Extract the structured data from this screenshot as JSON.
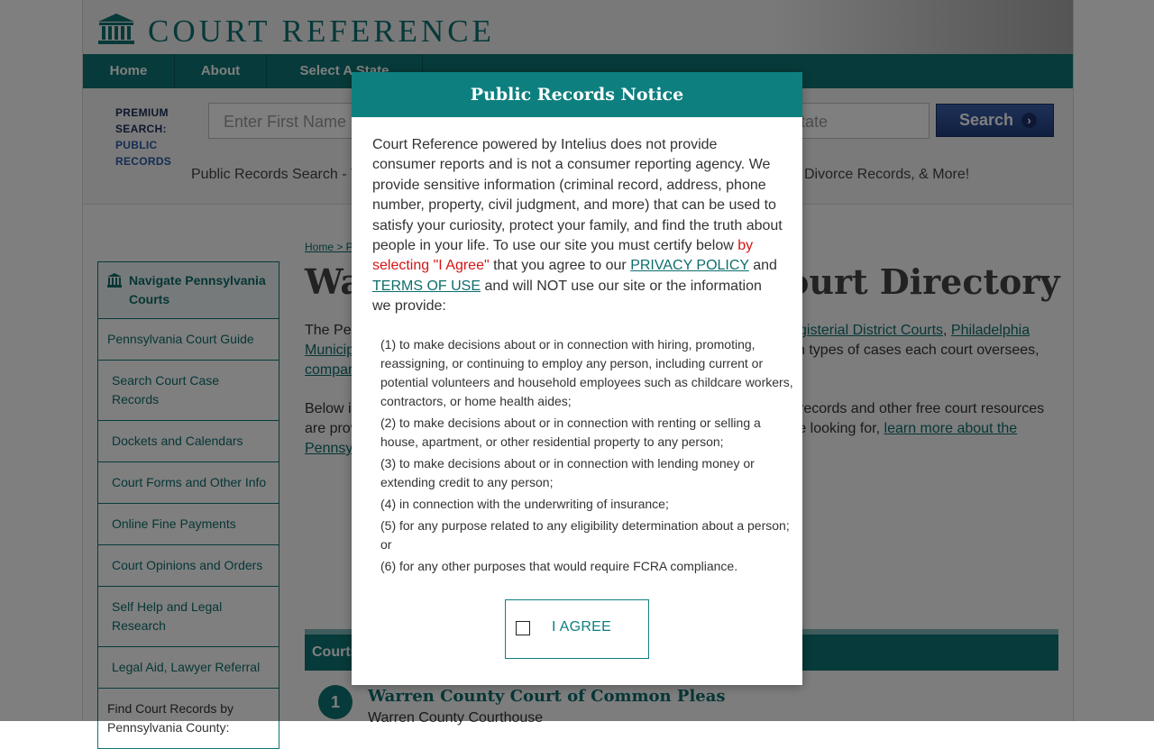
{
  "site": {
    "logo_text": "COURT REFERENCE"
  },
  "nav": {
    "items": [
      {
        "label": "Home"
      },
      {
        "label": "About"
      },
      {
        "label": "Select A State"
      }
    ]
  },
  "search": {
    "premium_line1": "PREMIUM",
    "premium_line2": "SEARCH:",
    "premium_line3": "PUBLIC",
    "premium_line4": "RECORDS",
    "first_name_placeholder": "Enter First Name",
    "state_placeholder": "tate",
    "button_label": "Search",
    "tagline_left": "Public Records Search - Y",
    "tagline_right": "Divorce Records, & More!"
  },
  "sidebar": {
    "heading": "Navigate Pennsylvania Courts",
    "items": [
      {
        "label": "Pennsylvania Court Guide"
      },
      {
        "label": "Search Court Case Records"
      },
      {
        "label": "Dockets and Calendars"
      },
      {
        "label": "Court Forms and Other Info"
      },
      {
        "label": "Online Fine Payments"
      },
      {
        "label": "Court Opinions and Orders"
      },
      {
        "label": "Self Help and Legal Research"
      },
      {
        "label": "Legal Aid, Lawyer Referral"
      },
      {
        "label": "Find Court Records by Pennsylvania County:"
      }
    ]
  },
  "main": {
    "breadcrumb": "Home > P",
    "title_left": "Wa",
    "title_right": "ourt Directory",
    "p1_left": "The Pe",
    "p1_link1": "gisterial District Courts",
    "p1_link2": "Philadelphia",
    "p1_line2_left": "Municip",
    "p1_line2_right": "ch types of cases each court oversees,",
    "p1_line3_left": "compar",
    "p2_left": "Below i",
    "p2_right": "records and other free court resources",
    "p2_line2_left": "are prov",
    "p2_line2_right": "re looking for,",
    "p2_link": "learn more about the",
    "p2_line3_left": "Pennsy",
    "courts_bar": "Courts",
    "court_num": "1",
    "court_name": "Warren County Court of Common Pleas",
    "court_sub": "Warren County Courthouse"
  },
  "modal": {
    "title": "Public Records Notice",
    "intro_before": "Court Reference powered by Intelius does not provide consumer reports and is not a consumer reporting agency. We provide sensitive information (criminal record, address, phone number, property, civil judgment, and more) that can be used to satisfy your curiosity, protect your family, and find the truth about people in your life. To use our site you must certify below ",
    "intro_red": "by selecting \"I Agree\"",
    "intro_mid": " that you agree to our ",
    "privacy_link": "PRIVACY POLICY",
    "intro_and": " and ",
    "terms_link": "TERMS OF USE",
    "intro_after": " and will NOT use our site or the information we provide:",
    "list": [
      "(1) to make decisions about or in connection with hiring, promoting, reassigning, or continuing to employ any person, including current or potential volunteers and household employees such as childcare workers, contractors, or home health aides;",
      "(2) to make decisions about or in connection with renting or selling a house, apartment, or other residential property to any person;",
      "(3) to make decisions about or in connection with lending money or extending credit to any person;",
      "(4) in connection with the underwriting of insurance;",
      "(5) for any purpose related to any eligibility determination about a person; or",
      "(6) for any other purposes that would require FCRA compliance."
    ],
    "agree_label": "I AGREE"
  }
}
